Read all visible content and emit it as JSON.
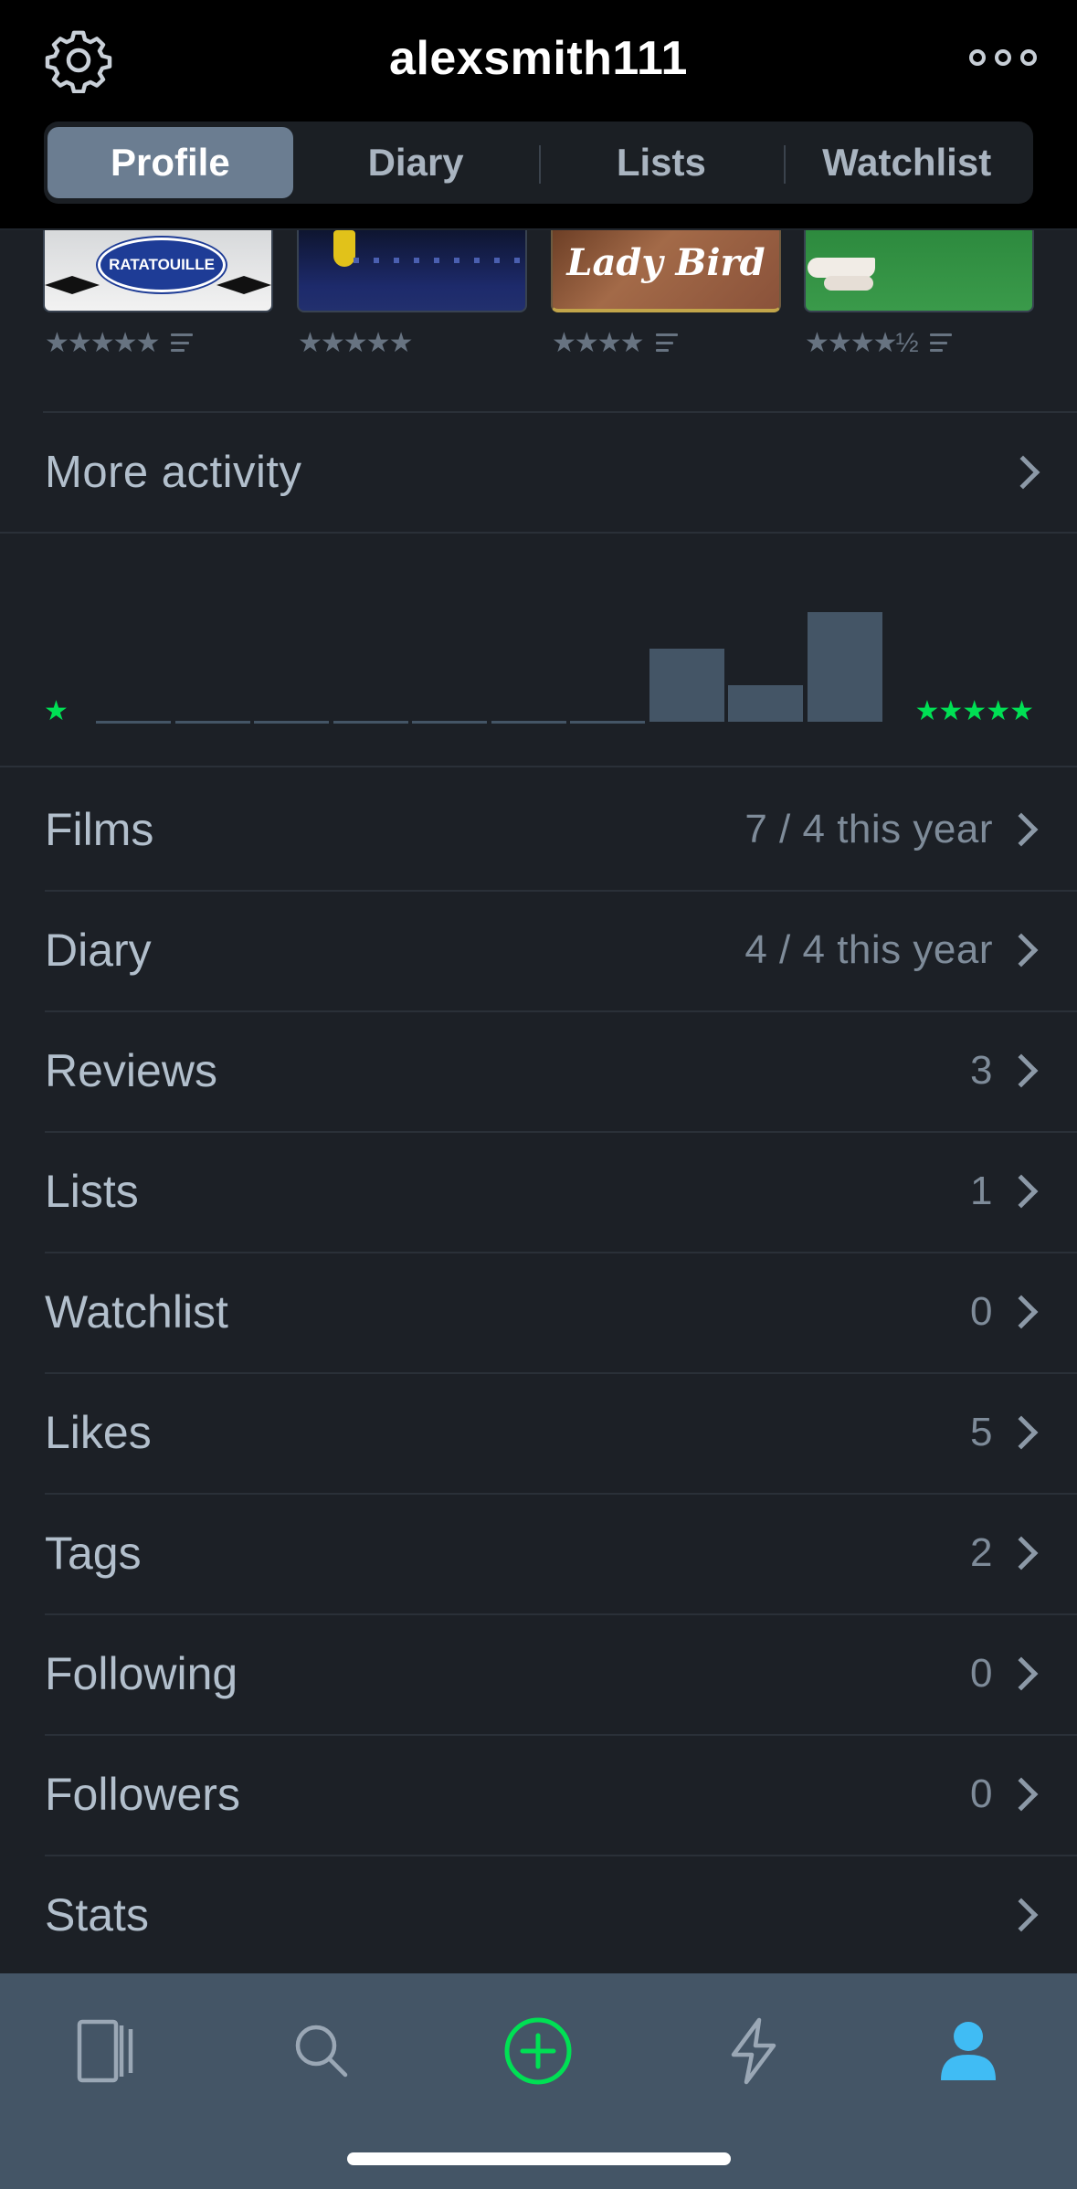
{
  "header": {
    "title": "alexsmith111",
    "tabs": [
      {
        "label": "Profile",
        "active": true
      },
      {
        "label": "Diary",
        "active": false
      },
      {
        "label": "Lists",
        "active": false
      },
      {
        "label": "Watchlist",
        "active": false
      }
    ]
  },
  "recent_films": [
    {
      "poster_text": "RATATOUILLE",
      "rating": "★★★★★",
      "has_review": true
    },
    {
      "poster_text": "",
      "rating": "★★★★★",
      "has_review": false
    },
    {
      "poster_text": "Lady Bird",
      "rating": "★★★★",
      "has_review": true
    },
    {
      "poster_text": "",
      "rating": "★★★★½",
      "has_review": true
    }
  ],
  "more_activity": {
    "label": "More activity"
  },
  "ratings_histogram": {
    "low_label": "★",
    "high_label": "★★★★★",
    "accent": "#00e054",
    "bar_color": "#445566",
    "counts": [
      0,
      0,
      0,
      0,
      0,
      0,
      0,
      2,
      1,
      3
    ]
  },
  "stats_rows": [
    {
      "label": "Films",
      "value": "7 / 4 this year"
    },
    {
      "label": "Diary",
      "value": "4 / 4 this year"
    },
    {
      "label": "Reviews",
      "value": "3"
    },
    {
      "label": "Lists",
      "value": "1"
    },
    {
      "label": "Watchlist",
      "value": "0"
    },
    {
      "label": "Likes",
      "value": "5"
    },
    {
      "label": "Tags",
      "value": "2"
    },
    {
      "label": "Following",
      "value": "0"
    },
    {
      "label": "Followers",
      "value": "0"
    },
    {
      "label": "Stats",
      "value": ""
    }
  ],
  "tabbar": {
    "items": [
      {
        "icon": "films-icon",
        "active": false
      },
      {
        "icon": "search-icon",
        "active": false
      },
      {
        "icon": "add-icon",
        "active": false
      },
      {
        "icon": "activity-icon",
        "active": false
      },
      {
        "icon": "profile-icon",
        "active": true
      }
    ],
    "active_color": "#40bcf4",
    "add_color": "#00e054"
  }
}
